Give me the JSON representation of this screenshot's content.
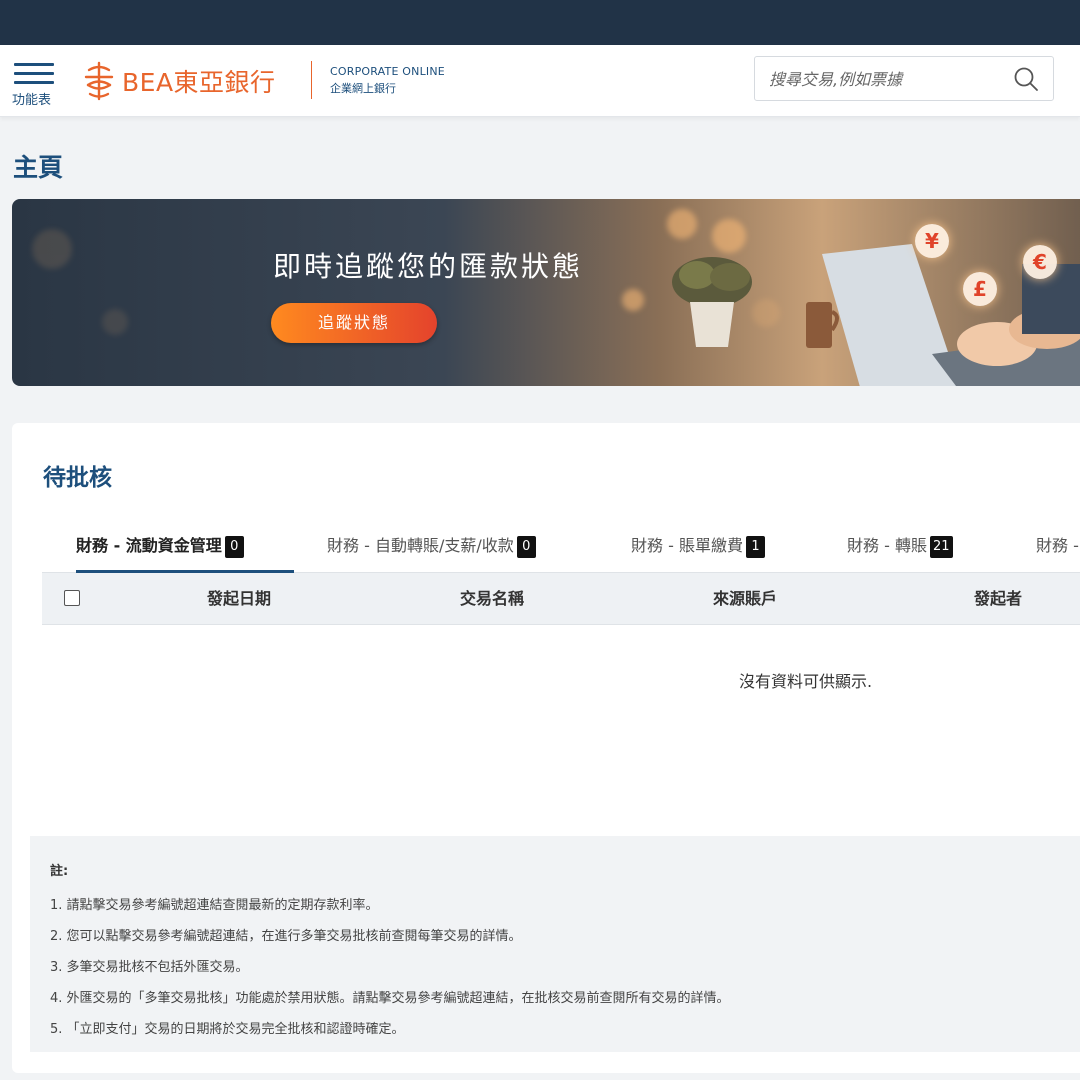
{
  "header": {
    "menu_label": "功能表",
    "brand_name": "BEA東亞銀行",
    "product_en": "CORPORATE ONLINE",
    "product_zh": "企業網上銀行",
    "search_placeholder": "搜尋交易,例如票據"
  },
  "page": {
    "title": "主頁"
  },
  "banner": {
    "headline": "即時追蹤您的匯款狀態",
    "button_label": "追蹤狀態",
    "currency_symbols": [
      "¥",
      "€",
      "£"
    ]
  },
  "pending": {
    "title": "待批核",
    "tabs": [
      {
        "label": "財務 - 流動資金管理",
        "count": "0"
      },
      {
        "label": "財務 - 自動轉賬/支薪/收款",
        "count": "0"
      },
      {
        "label": "財務 - 賬單繳費",
        "count": "1"
      },
      {
        "label": "財務 - 轉賬",
        "count": "21"
      },
      {
        "label": "財務 -",
        "count": ""
      }
    ],
    "columns": [
      "發起日期",
      "交易名稱",
      "來源賬戶",
      "發起者"
    ],
    "empty_message": "沒有資料可供顯示."
  },
  "notes": {
    "label": "註:",
    "items": [
      "1. 請點擊交易參考編號超連結查閱最新的定期存款利率。",
      "2. 您可以點擊交易參考編號超連結，在進行多筆交易批核前查閱每筆交易的詳情。",
      "3. 多筆交易批核不包括外匯交易。",
      "4. 外匯交易的「多筆交易批核」功能處於禁用狀態。請點擊交易參考編號超連結，在批核交易前查閱所有交易的詳情。",
      "5. 「立即支付」交易的日期將於交易完全批核和認證時確定。"
    ]
  },
  "colors": {
    "brand_navy": "#213347",
    "brand_blue": "#1d4f7c",
    "brand_orange": "#e8652c"
  }
}
